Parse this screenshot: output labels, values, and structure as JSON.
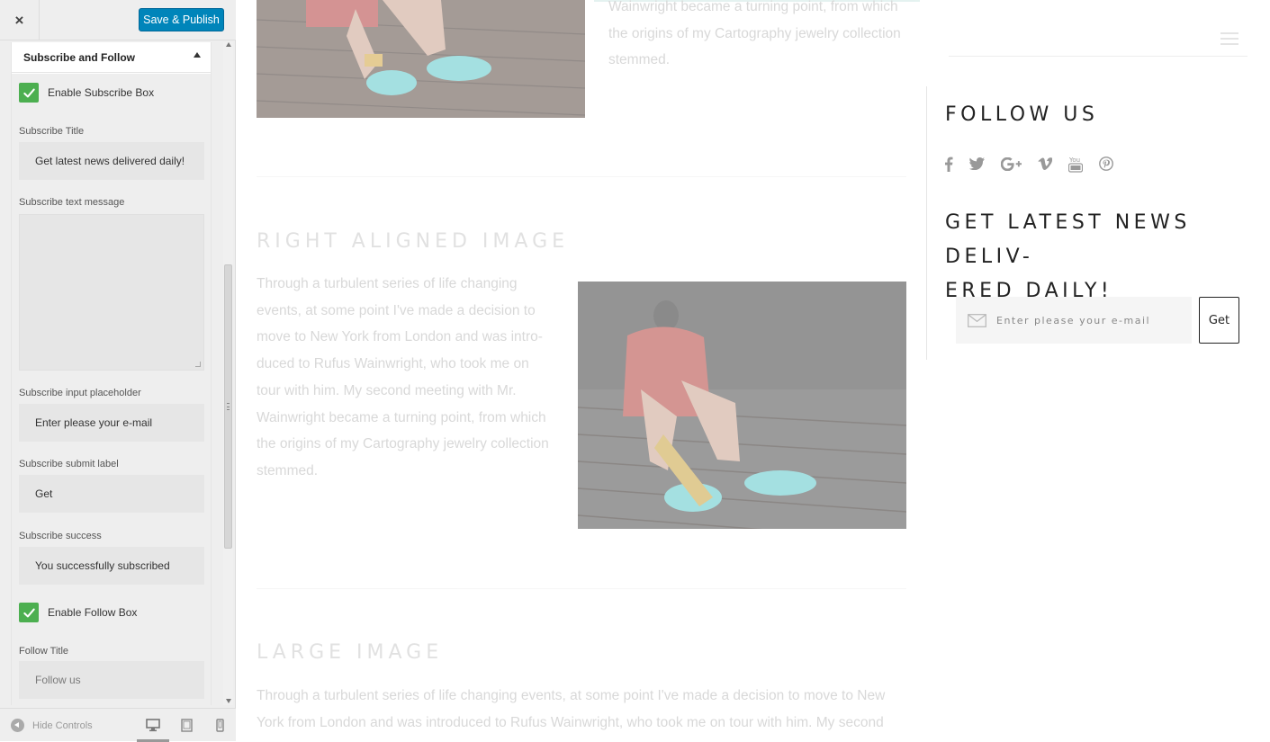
{
  "customizer": {
    "close_label": "×",
    "save_label": "Save & Publish",
    "section_title": "Subscribe and Follow",
    "enable_subscribe_label": "Enable Subscribe Box",
    "subscribe_title_label": "Subscribe Title",
    "subscribe_title_value": "Get latest news delivered daily!",
    "subscribe_text_label": "Subscribe text message",
    "subscribe_text_value": "",
    "placeholder_label": "Subscribe input placeholder",
    "placeholder_value": "Enter please your e-mail",
    "submit_label": "Subscribe submit label",
    "submit_value": "Get",
    "success_label": "Subscribe success",
    "success_value": "You successfully subscribed",
    "enable_follow_label": "Enable Follow Box",
    "follow_title_label": "Follow Title",
    "follow_title_placeholder": "Follow us",
    "hide_controls_label": "Hide Controls",
    "accent_color": "#0085ba",
    "checkbox_color": "#4caf50",
    "checkboxes_checked": [
      true,
      true
    ],
    "devices": [
      "desktop-icon",
      "tablet-icon",
      "mobile-icon"
    ],
    "active_device": "desktop"
  },
  "preview": {
    "top_text_lines": [
      "Wainwright became a turning point, from which",
      "the origins of my Cartography jewelry collection",
      "stemmed."
    ],
    "right_aligned_heading": "RIGHT ALIGNED IMAGE",
    "right_aligned_lines": [
      "Through a turbulent series of life changing",
      "events, at some point I've made a decision to",
      "move to New York from London and was intro-",
      "duced to Rufus Wainwright, who took me on",
      "tour with him. My second meeting with Mr.",
      "Wainwright became a turning point, from which",
      "the origins of my Cartography jewelry collection",
      "stemmed."
    ],
    "large_image_heading": "LARGE IMAGE",
    "large_image_lines": [
      "Through a turbulent series of life changing events, at some point I've made a decision to move to New",
      "York from London and was introduced to Rufus Wainwright, who took me on tour with him. My second"
    ]
  },
  "widget": {
    "follow_title": "FOLLOW US",
    "social_icons": [
      "facebook-icon",
      "twitter-icon",
      "google-plus-icon",
      "vimeo-icon",
      "youtube-icon",
      "pinterest-icon"
    ],
    "news_title_line1": "GET LATEST NEWS DELIV-",
    "news_title_line2": "ERED DAILY!",
    "email_placeholder": "Enter please your e-mail",
    "submit_label": "Get"
  }
}
